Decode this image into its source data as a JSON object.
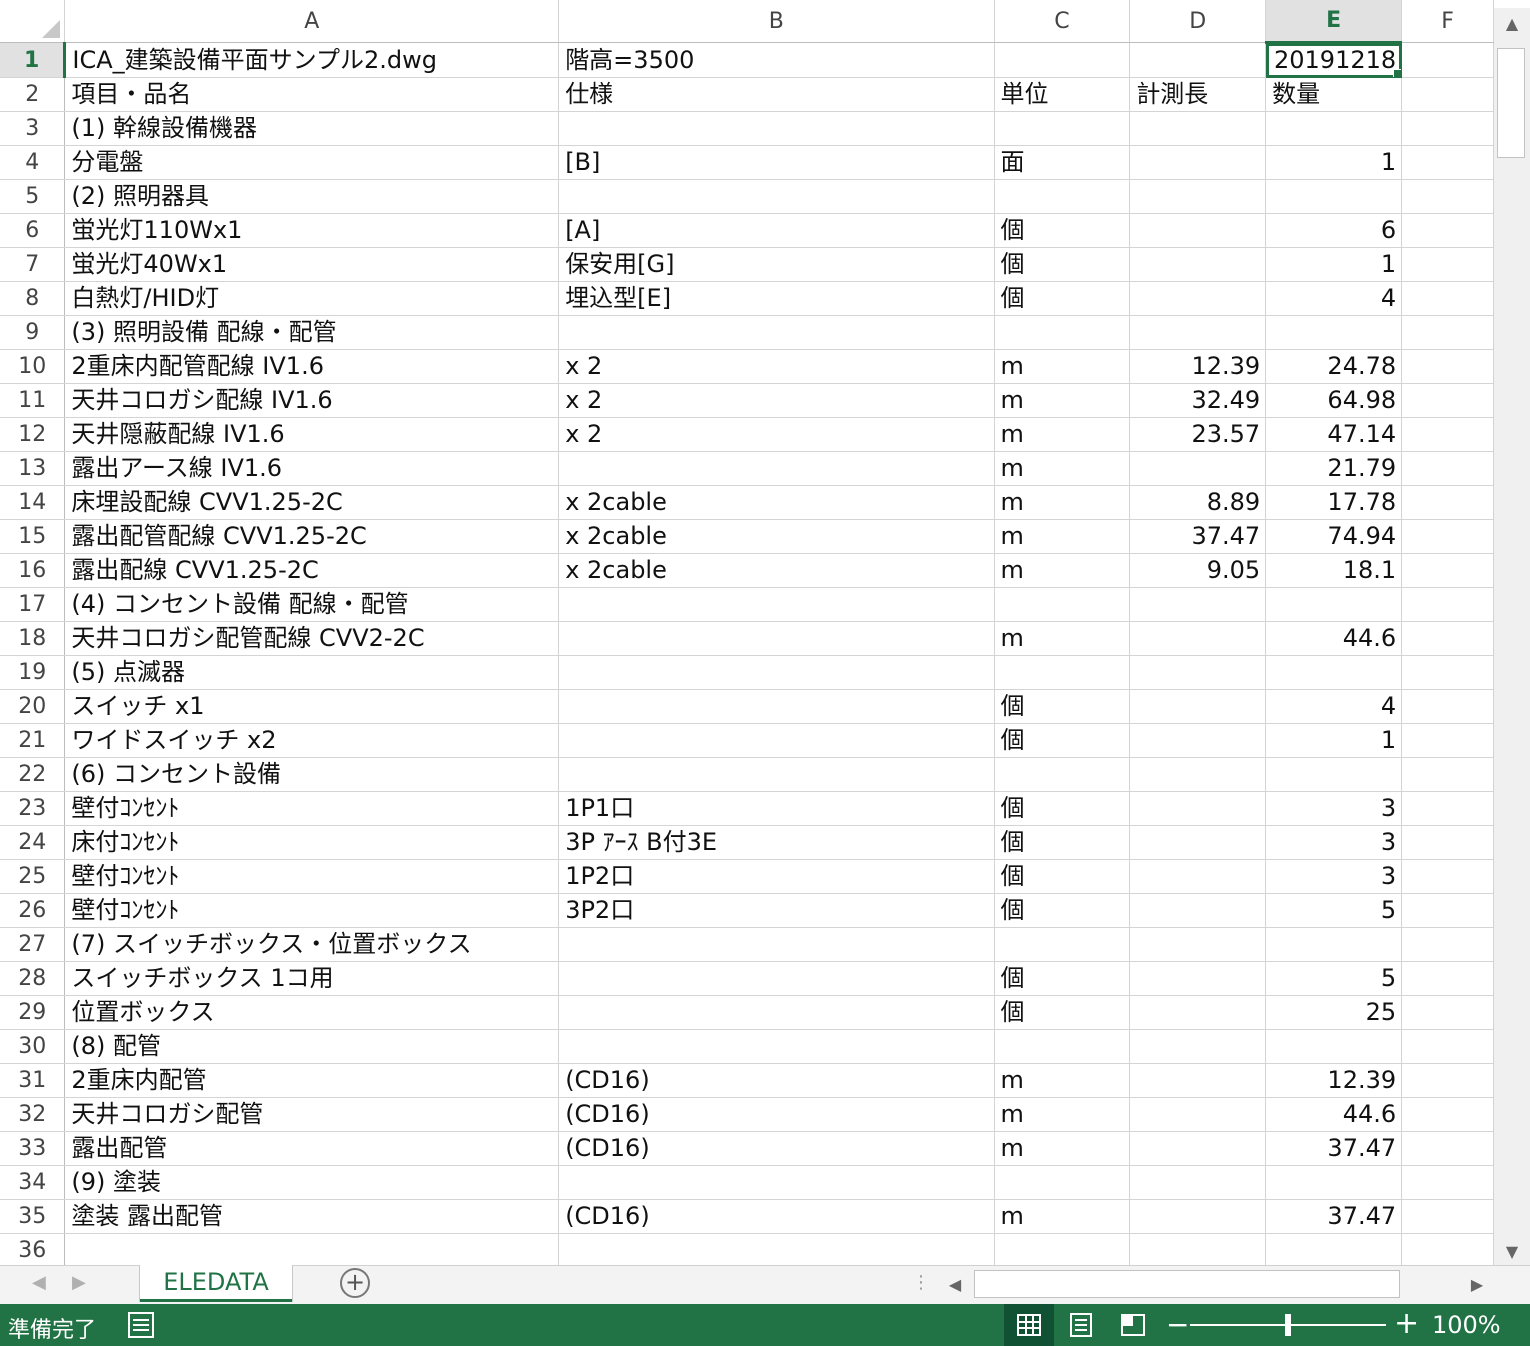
{
  "columns": [
    "A",
    "B",
    "C",
    "D",
    "E",
    "F"
  ],
  "selected_column": "E",
  "selected_row": 1,
  "rows": [
    {
      "n": "1",
      "a": "ICA_建築設備平面サンプル2.dwg",
      "b": "階高=3500",
      "c": "",
      "d": "",
      "e": "20191218"
    },
    {
      "n": "2",
      "a": "項目・品名",
      "b": "仕様",
      "c": "単位",
      "d": "計測長",
      "e": "数量"
    },
    {
      "n": "3",
      "a": "(1) 幹線設備機器",
      "b": "",
      "c": "",
      "d": "",
      "e": ""
    },
    {
      "n": "4",
      "a": "分電盤",
      "b": "[B]",
      "c": "面",
      "d": "",
      "e": "1"
    },
    {
      "n": "5",
      "a": "(2) 照明器具",
      "b": "",
      "c": "",
      "d": "",
      "e": ""
    },
    {
      "n": "6",
      "a": "蛍光灯110Wx1",
      "b": "[A]",
      "c": "個",
      "d": "",
      "e": "6"
    },
    {
      "n": "7",
      "a": "蛍光灯40Wx1",
      "b": "保安用[G]",
      "c": "個",
      "d": "",
      "e": "1"
    },
    {
      "n": "8",
      "a": "白熱灯/HID灯",
      "b": "埋込型[E]",
      "c": "個",
      "d": "",
      "e": "4"
    },
    {
      "n": "9",
      "a": "(3) 照明設備 配線・配管",
      "b": "",
      "c": "",
      "d": "",
      "e": ""
    },
    {
      "n": "10",
      "a": "2重床内配管配線 IV1.6",
      "b": " x 2",
      "c": "m",
      "d": "12.39",
      "e": "24.78"
    },
    {
      "n": "11",
      "a": "天井コロガシ配線 IV1.6",
      "b": " x 2",
      "c": "m",
      "d": "32.49",
      "e": "64.98"
    },
    {
      "n": "12",
      "a": "天井隠蔽配線 IV1.6",
      "b": " x 2",
      "c": "m",
      "d": "23.57",
      "e": "47.14"
    },
    {
      "n": "13",
      "a": "露出アース線 IV1.6",
      "b": "",
      "c": "m",
      "d": "",
      "e": "21.79"
    },
    {
      "n": "14",
      "a": "床埋設配線 CVV1.25-2C",
      "b": " x 2cable",
      "c": "m",
      "d": "8.89",
      "e": "17.78"
    },
    {
      "n": "15",
      "a": "露出配管配線 CVV1.25-2C",
      "b": " x 2cable",
      "c": "m",
      "d": "37.47",
      "e": "74.94"
    },
    {
      "n": "16",
      "a": "露出配線 CVV1.25-2C",
      "b": " x 2cable",
      "c": "m",
      "d": "9.05",
      "e": "18.1"
    },
    {
      "n": "17",
      "a": "(4) コンセント設備 配線・配管",
      "b": "",
      "c": "",
      "d": "",
      "e": ""
    },
    {
      "n": "18",
      "a": "天井コロガシ配管配線 CVV2-2C",
      "b": "",
      "c": "m",
      "d": "",
      "e": "44.6"
    },
    {
      "n": "19",
      "a": "(5) 点滅器",
      "b": "",
      "c": "",
      "d": "",
      "e": ""
    },
    {
      "n": "20",
      "a": "スイッチ x1",
      "b": "",
      "c": "個",
      "d": "",
      "e": "4"
    },
    {
      "n": "21",
      "a": "ワイドスイッチ x2",
      "b": "",
      "c": "個",
      "d": "",
      "e": "1"
    },
    {
      "n": "22",
      "a": "(6) コンセント設備",
      "b": "",
      "c": "",
      "d": "",
      "e": ""
    },
    {
      "n": "23",
      "a": "壁付ｺﾝｾﾝﾄ",
      "b": "1P1口",
      "c": "個",
      "d": "",
      "e": "3"
    },
    {
      "n": "24",
      "a": "床付ｺﾝｾﾝﾄ",
      "b": "3P ｱｰｽ B付3E",
      "c": "個",
      "d": "",
      "e": "3"
    },
    {
      "n": "25",
      "a": "壁付ｺﾝｾﾝﾄ",
      "b": "1P2口",
      "c": "個",
      "d": "",
      "e": "3"
    },
    {
      "n": "26",
      "a": "壁付ｺﾝｾﾝﾄ",
      "b": "3P2口",
      "c": "個",
      "d": "",
      "e": "5"
    },
    {
      "n": "27",
      "a": "(7) スイッチボックス・位置ボックス",
      "b": "",
      "c": "",
      "d": "",
      "e": ""
    },
    {
      "n": "28",
      "a": "スイッチボックス 1コ用",
      "b": "",
      "c": "個",
      "d": "",
      "e": "5"
    },
    {
      "n": "29",
      "a": "位置ボックス",
      "b": "",
      "c": "個",
      "d": "",
      "e": "25"
    },
    {
      "n": "30",
      "a": "(8) 配管",
      "b": "",
      "c": "",
      "d": "",
      "e": ""
    },
    {
      "n": "31",
      "a": "2重床内配管",
      "b": "(CD16)",
      "c": "m",
      "d": "",
      "e": "12.39"
    },
    {
      "n": "32",
      "a": "天井コロガシ配管",
      "b": "(CD16)",
      "c": "m",
      "d": "",
      "e": "44.6"
    },
    {
      "n": "33",
      "a": "露出配管",
      "b": "(CD16)",
      "c": "m",
      "d": "",
      "e": "37.47"
    },
    {
      "n": "34",
      "a": "(9) 塗装",
      "b": "",
      "c": "",
      "d": "",
      "e": ""
    },
    {
      "n": "35",
      "a": "塗装 露出配管",
      "b": "(CD16)",
      "c": "m",
      "d": "",
      "e": "37.47"
    },
    {
      "n": "36",
      "a": "",
      "b": "",
      "c": "",
      "d": "",
      "e": ""
    }
  ],
  "sheet_tabs": [
    "ELEDATA"
  ],
  "active_sheet": "ELEDATA",
  "status": {
    "ready_text": "準備完了",
    "zoom_level": "100%",
    "zoom_fraction": 0.5
  },
  "icons": {
    "add_sheet": "plus-circle-icon",
    "macro": "macro-record-icon",
    "views": [
      "normal-view-icon",
      "page-layout-view-icon",
      "page-break-preview-icon"
    ]
  },
  "colors": {
    "accent": "#217346",
    "status_bar": "#217346",
    "gridline": "#d4d4d4",
    "header_selected_bg": "#e1e1e1"
  }
}
